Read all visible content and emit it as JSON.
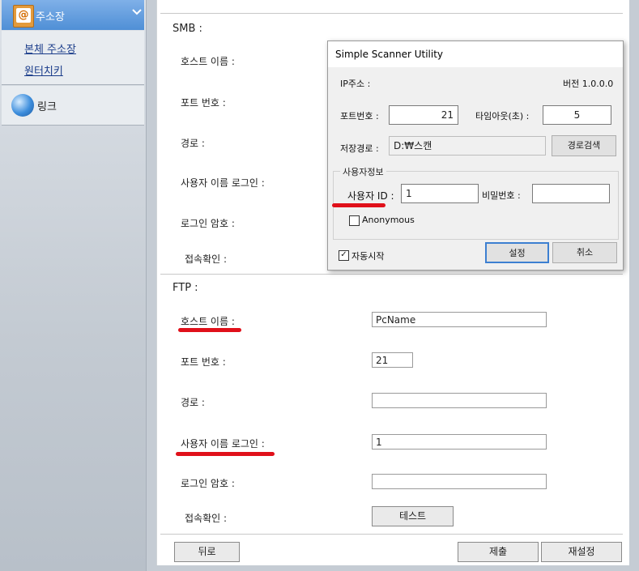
{
  "sidebar": {
    "header_title": "주소장",
    "header_icon": "address-book-icon",
    "items": [
      {
        "label": "본체 주소장"
      },
      {
        "label": "원터치키"
      }
    ],
    "link_label": "링크"
  },
  "smb": {
    "title": "SMB :",
    "fields": [
      {
        "label": "호스트 이름 :"
      },
      {
        "label": "포트 번호 :"
      },
      {
        "label": "경로 :"
      },
      {
        "label": "사용자 이름 로그인 :"
      },
      {
        "label": "로그인 암호 :"
      },
      {
        "label": "접속확인 :"
      }
    ]
  },
  "ftp": {
    "title": "FTP :",
    "fields": [
      {
        "label": "호스트 이름 :",
        "value": "PcName"
      },
      {
        "label": "포트 번호 :",
        "value": "21"
      },
      {
        "label": "경로 :",
        "value": ""
      },
      {
        "label": "사용자 이름 로그인 :",
        "value": "1"
      },
      {
        "label": "로그인 암호 :",
        "value": ""
      },
      {
        "label": "접속확인 :"
      }
    ],
    "test_button": "테스트"
  },
  "footer": {
    "back": "뒤로",
    "submit": "제출",
    "reset": "재설정"
  },
  "dialog": {
    "title": "Simple Scanner Utility",
    "ip_label": "IP주소 :",
    "version": "버전 1.0.0.0",
    "port_label": "포트번호 :",
    "port_value": "21",
    "timeout_label": "타임아웃(초) :",
    "timeout_value": "5",
    "path_label": "저장경로 :",
    "path_value": "D:₩스캔",
    "browse_button": "경로검색",
    "group_title": "사용자정보",
    "user_id_label": "사용자 ID :",
    "user_id_value": "1",
    "password_label": "비밀번호 :",
    "password_value": "",
    "anonymous_label": "Anonymous",
    "anonymous_checked": false,
    "autostart_label": "자동시작",
    "autostart_checked": true,
    "ok_button": "설정",
    "cancel_button": "취소"
  },
  "colors": {
    "sidebar_header": "#4f8fd6",
    "link": "#1a3c8a",
    "underline_annotation": "#e0101a"
  }
}
